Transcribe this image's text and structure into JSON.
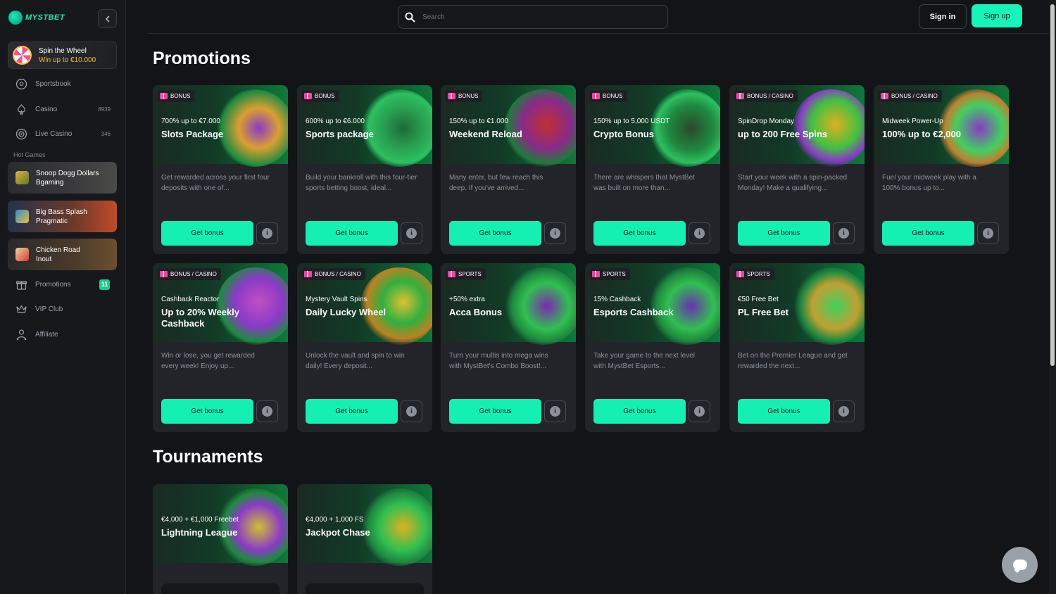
{
  "brand": {
    "name": "MYSTBET"
  },
  "sidebar": {
    "collapse_icon": "chevron-left-icon",
    "spin_wheel": {
      "title": "Spin the Wheel",
      "subtitle": "Win up to €10.000"
    },
    "nav": [
      {
        "label": "Sportsbook",
        "icon": "soccer-ball-icon",
        "count": ""
      },
      {
        "label": "Casino",
        "icon": "spade-icon",
        "count": "8939"
      },
      {
        "label": "Live Casino",
        "icon": "live-target-icon",
        "count": "346"
      }
    ],
    "hot_games_label": "Hot Games",
    "hot_games": [
      {
        "line1": "Snoop Dogg Dollars",
        "line2": "Bgaming"
      },
      {
        "line1": "Big Bass Splash",
        "line2": "Pragmatic"
      },
      {
        "line1": "Chicken Road",
        "line2": "Inout"
      }
    ],
    "nav_bottom": [
      {
        "label": "Promotions",
        "icon": "gift-icon",
        "badge": "11"
      },
      {
        "label": "VIP Club",
        "icon": "crown-icon",
        "badge": ""
      },
      {
        "label": "Affiliate",
        "icon": "user-network-icon",
        "badge": ""
      }
    ]
  },
  "header": {
    "search_placeholder": "Search",
    "signin_label": "Sign in",
    "signup_label": "Sign up"
  },
  "promotions": {
    "title": "Promotions",
    "button_label": "Get bonus",
    "items": [
      {
        "tag": "BONUS",
        "subtitle": "700% up to €7.000",
        "title": "Slots Package",
        "desc": "Get rewarded across your first four deposits with one of..."
      },
      {
        "tag": "BONUS",
        "subtitle": "600% up to €6.000",
        "title": "Sports package",
        "desc": "Build your bankroll with this four-tier sports betting boost, ideal..."
      },
      {
        "tag": "BONUS",
        "subtitle": "150% up to €1.000",
        "title": "Weekend Reload",
        "desc": "Many enter, but few reach this deep. If you've arrived..."
      },
      {
        "tag": "BONUS",
        "subtitle": "150% up to 5,000 USDT",
        "title": "Crypto Bonus",
        "desc": "There are whispers that MystBet was built on more than..."
      },
      {
        "tag": "BONUS / CASINO",
        "subtitle": "SpinDrop Monday",
        "title": "up to 200 Free Spins",
        "desc": "Start your week with a spin-packed Monday! Make a qualifying..."
      },
      {
        "tag": "BONUS / CASINO",
        "subtitle": "Midweek Power-Up",
        "title": "100% up to €2,000",
        "desc": "Fuel your midweek play with a 100% bonus up to..."
      },
      {
        "tag": "BONUS / CASINO",
        "subtitle": "Cashback Reactor",
        "title": "Up to 20% Weekly Cashback",
        "desc": "Win or lose, you get rewarded every week! Enjoy up..."
      },
      {
        "tag": "BONUS / CASINO",
        "subtitle": "Mystery Vault Spins",
        "title": "Daily Lucky Wheel",
        "desc": "Unlock the vault and spin to win daily! Every deposit..."
      },
      {
        "tag": "SPORTS",
        "subtitle": "+50% extra",
        "title": "Acca Bonus",
        "desc": "Turn your multis into mega wins with MystBet's Combo Boost!..."
      },
      {
        "tag": "SPORTS",
        "subtitle": "15% Cashback",
        "title": "Esports Cashback",
        "desc": "Take your game to the next level with MystBet Esports..."
      },
      {
        "tag": "SPORTS",
        "subtitle": "€50 Free Bet",
        "title": "PL Free Bet",
        "desc": "Bet on the Premier League and get rewarded the next..."
      }
    ]
  },
  "tournaments": {
    "title": "Tournaments",
    "items": [
      {
        "subtitle": "€4,000 + €1,000 Freebet",
        "title": "Lightning League"
      },
      {
        "subtitle": "€4,000 + 1,000 FS",
        "title": "Jackpot Chase"
      }
    ]
  },
  "colors": {
    "accent": "#14f0b2",
    "badge": "#20c98e",
    "gold": "#f5b93a",
    "background": "#131417",
    "card": "#22242a"
  },
  "chat": {
    "icon": "chat-bubble-icon"
  }
}
